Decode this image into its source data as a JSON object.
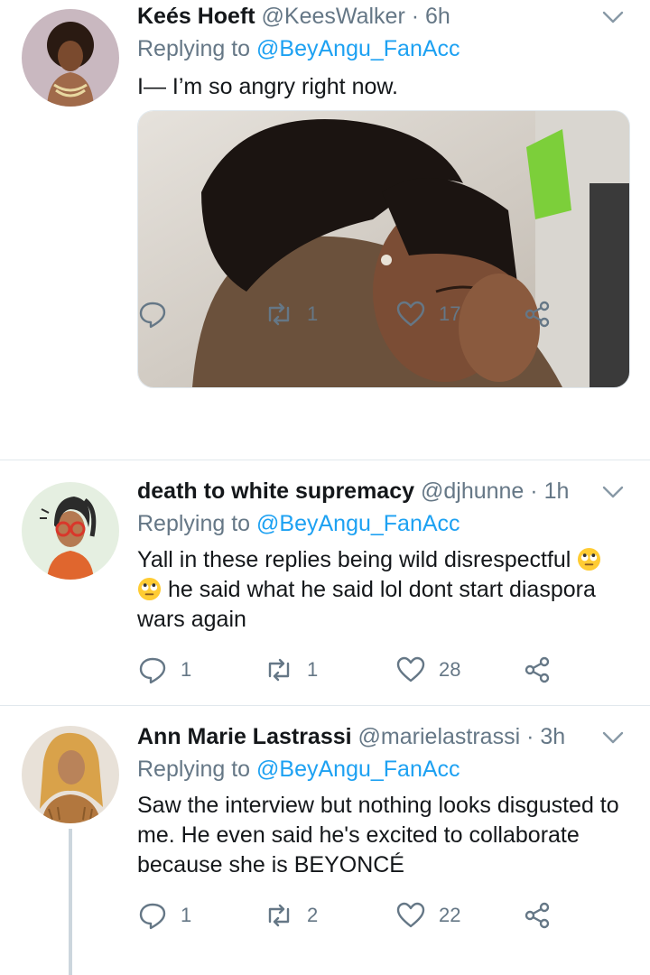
{
  "tweets": [
    {
      "name": "Keés Hoeft",
      "handle": "@KeesWalker",
      "time": "6h",
      "replying_label": "Replying to",
      "replying_to": "@BeyAngu_FanAcc",
      "text": "I— I’m so angry right now.",
      "replies": "",
      "retweets": "1",
      "likes": "17"
    },
    {
      "name": "death to white supremacy",
      "handle": "@djhunne",
      "time": "1h",
      "replying_label": "Replying to",
      "replying_to": "@BeyAngu_FanAcc",
      "text_part1": "Yall in these replies being wild disrespectful",
      "text_part2": "he said what he said lol dont start diaspora",
      "text_part3": "wars again",
      "replies": "1",
      "retweets": "1",
      "likes": "28"
    },
    {
      "name": "Ann Marie Lastrassi",
      "handle": "@marielastrassi",
      "time": "3h",
      "replying_label": "Replying to",
      "replying_to": "@BeyAngu_FanAcc",
      "text_line1": "Saw the interview but nothing looks disgusted to",
      "text_line2": "me. He even said he's excited to collaborate",
      "text_line3": "because she is BEYONCÉ",
      "replies": "1",
      "retweets": "2",
      "likes": "22"
    }
  ],
  "icons": {
    "more": "chevron-down-icon",
    "reply": "reply-icon",
    "retweet": "retweet-icon",
    "like": "heart-icon",
    "share": "share-icon",
    "emoji": "face-with-rolling-eyes-emoji"
  },
  "colors": {
    "link": "#1da1f2",
    "muted": "#657786",
    "divider": "#e1e8ed",
    "thread": "#ccd6dd"
  }
}
